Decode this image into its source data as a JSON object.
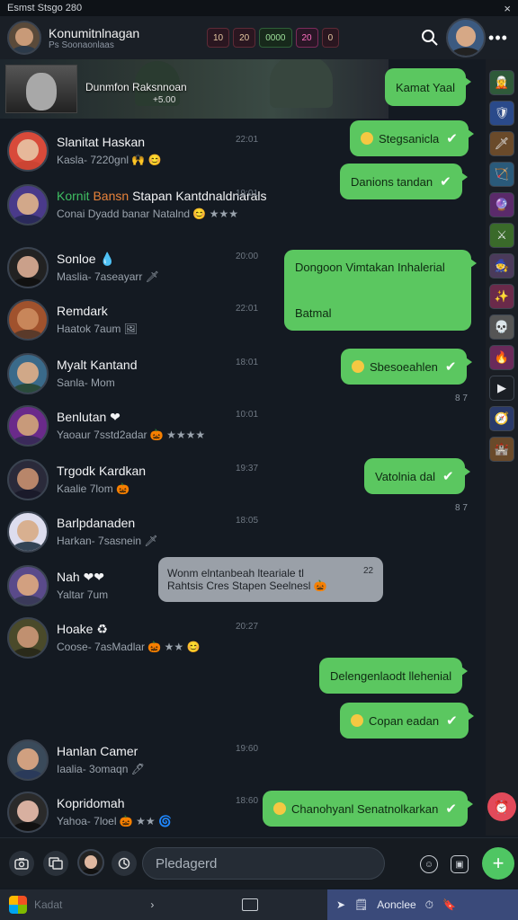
{
  "statusbar": {
    "title": "Esmst Stsgo 280",
    "close": "×"
  },
  "header": {
    "title": "Konumitnlnagan",
    "subtitle": "Ps Soonaonlaas",
    "hud": [
      "10",
      "20",
      "0000",
      "20",
      "0"
    ],
    "more": "•••"
  },
  "banner": {
    "caption": "Dunmfon Raksnnoan",
    "sub": "+5.00"
  },
  "rail": {
    "apps": [
      "🧝",
      "🛡",
      "🗡",
      "🏹",
      "🔮",
      "⚔",
      "🧙",
      "✨",
      "💀",
      "🔥",
      "▶",
      "🧭",
      "🏰"
    ],
    "notify": "⏰"
  },
  "chats": [
    {
      "name": "Slanitat Haskan",
      "preview": "Kasla- 7220gnl 🙌 😊",
      "time": "22:01"
    },
    {
      "name_green": "Kornit",
      "name_orange": "Bansn",
      "name_rest": "Stapan Kantdnaldnarals",
      "preview": "Conai Dyadd banar Natalnd 😊 ★★★",
      "time": "19:01"
    },
    {
      "name": "Sonloe 💧",
      "preview": "Maslia- 7aseayarr 🗡",
      "time": "20:00"
    },
    {
      "name": "Remdark",
      "preview": "Haatok 7aum 🖼",
      "time": "22:01"
    },
    {
      "name": "Myalt Kantand",
      "preview": "Sanla- Mom",
      "time": "18:01"
    },
    {
      "name": "Benlutan ❤",
      "preview": "Yaoaur 7sstd2adar 🎃 ★★★★",
      "time": "10:01"
    },
    {
      "name": "Trgodk Kardkan",
      "preview": "Kaalie 7lom 🎃",
      "time": "19:37"
    },
    {
      "name": "Barlpdanaden",
      "preview": "Harkan- 7sasnein 🗡",
      "time": "18:05"
    },
    {
      "name": "Nah ❤❤",
      "preview": "Yaltar 7um",
      "time": "20:20"
    },
    {
      "name": "Hoake ♻",
      "preview": "Coose- 7asMadlar 🎃 ★★ 😊",
      "time": "20:27"
    },
    {
      "name": "Hanlan Camer",
      "preview": "Iaalia- 3omaqn 🖊",
      "time": "19:60"
    },
    {
      "name": "Kopridomah",
      "preview": "Yahoa- 7loel 🎃 ★★ 🌀",
      "time": "18:60"
    }
  ],
  "bubbles": [
    {
      "text": "Kamat Yaal",
      "check": ""
    },
    {
      "text": "Stegsanicla",
      "check": "✔",
      "emoji": true
    },
    {
      "text": "Danions tandan",
      "check": "✔"
    },
    {
      "line1": "Dongoon Vimtakan Inhalerial",
      "line2": "Batmal"
    },
    {
      "text": "Sbesoeahlen",
      "check": "✔",
      "emoji": true
    },
    {
      "text": "Vatolnia dal",
      "check": "✔"
    },
    {
      "text": "Delengenlaodt llehenial",
      "check": ""
    },
    {
      "text": "Copan eadan",
      "check": "✔",
      "emoji": true
    },
    {
      "text": "Chanohyanl Senatnolkarkan",
      "check": "✔",
      "emoji": true
    }
  ],
  "gray_bubble": {
    "line1": "Wonm elntanbeah lteariale tl",
    "line2": "Rahtsis Cres Stapen Seelnesl 🎃",
    "time": "22"
  },
  "msg_times": [
    "8 7",
    "8 7"
  ],
  "composer": {
    "placeholder": "Pledagerd",
    "send": "+"
  },
  "taskbar": {
    "search": "Kadat",
    "action": "Aonclee"
  }
}
